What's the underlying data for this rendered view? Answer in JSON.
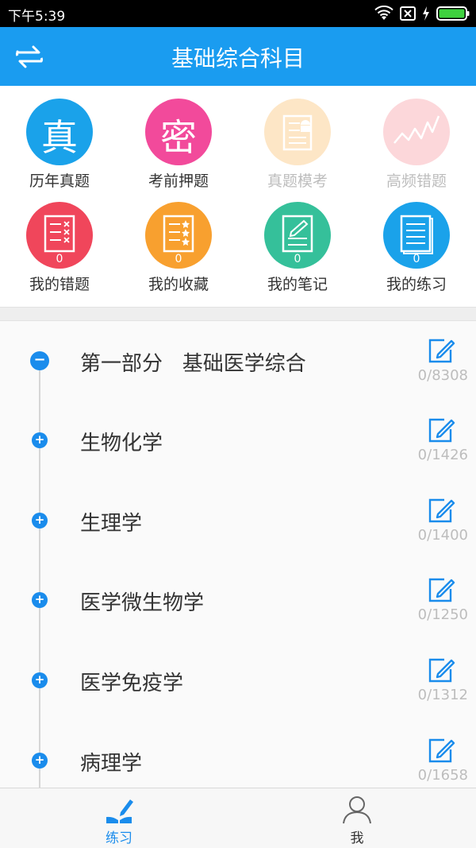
{
  "status_bar": {
    "time": "下午5:39"
  },
  "header": {
    "title": "基础综合科目"
  },
  "grid": {
    "row1": [
      {
        "label": "历年真题",
        "char": "真",
        "color": "#1aa2ea",
        "enabled": true
      },
      {
        "label": "考前押题",
        "char": "密",
        "color": "#f24a9b",
        "enabled": true
      },
      {
        "label": "真题模考",
        "color": "#fde6c6",
        "enabled": false
      },
      {
        "label": "高频错题",
        "color": "#fcd7da",
        "enabled": false
      }
    ],
    "row2": [
      {
        "label": "我的错题",
        "count": "0",
        "color": "#f0465b"
      },
      {
        "label": "我的收藏",
        "count": "0",
        "color": "#f8a02f"
      },
      {
        "label": "我的笔记",
        "count": "0",
        "color": "#35c09a"
      },
      {
        "label": "我的练习",
        "count": "0",
        "color": "#1aa2ea"
      }
    ]
  },
  "list": {
    "items": [
      {
        "name": "第一部分   基础医学综合",
        "progress": "0/8308",
        "expanded": true
      },
      {
        "name": "生物化学",
        "progress": "0/1426",
        "expanded": false
      },
      {
        "name": "生理学",
        "progress": "0/1400",
        "expanded": false
      },
      {
        "name": "医学微生物学",
        "progress": "0/1250",
        "expanded": false
      },
      {
        "name": "医学免疫学",
        "progress": "0/1312",
        "expanded": false
      },
      {
        "name": "病理学",
        "progress": "0/1658",
        "expanded": false
      }
    ]
  },
  "bottom_nav": {
    "tabs": [
      {
        "label": "练习",
        "icon": "pencil-book-icon",
        "active": true
      },
      {
        "label": "我",
        "icon": "person-icon",
        "active": false
      }
    ]
  },
  "colors": {
    "primary": "#1a9cf0",
    "active_tab": "#1a8cec",
    "muted": "#bdbdbd"
  }
}
